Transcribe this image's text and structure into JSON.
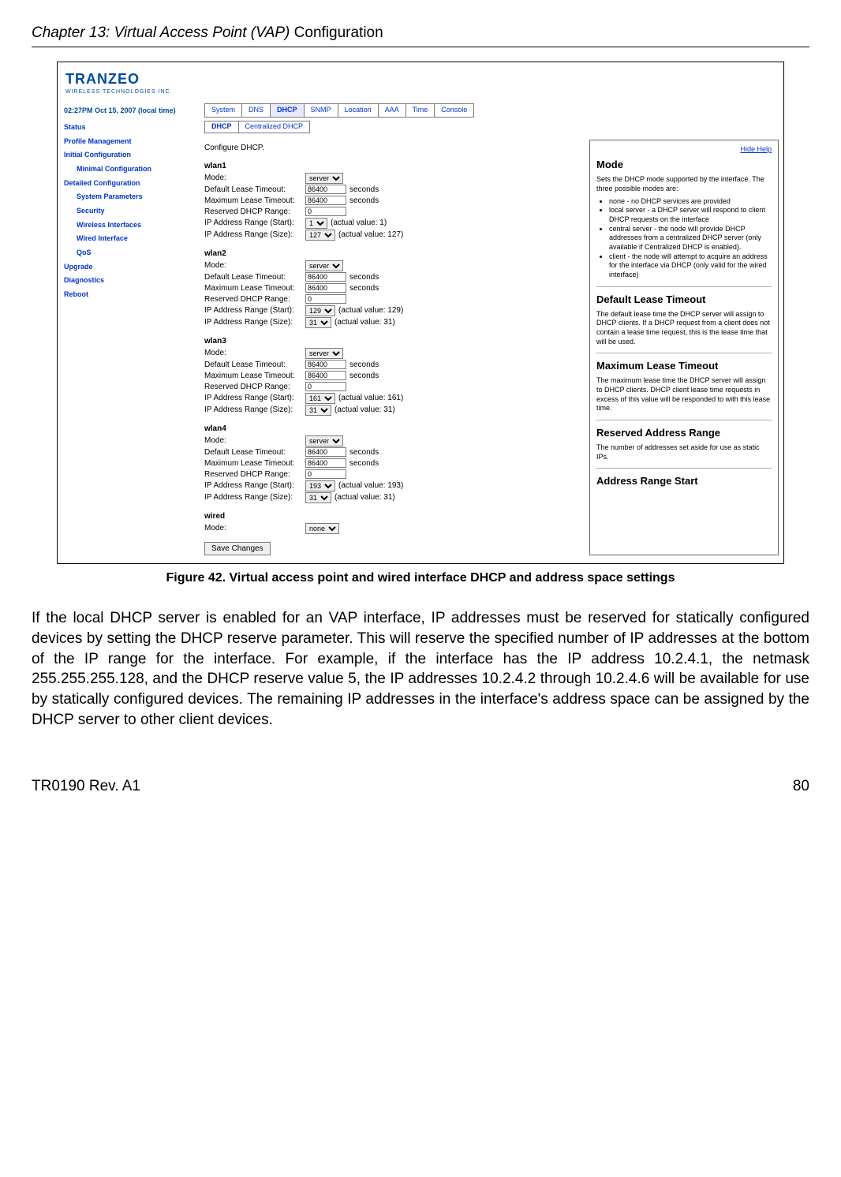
{
  "page": {
    "chapter_title_prefix": "Chapter 13: Virtual Access Point (VAP)",
    "chapter_title_suffix": "Configuration",
    "figure_caption": "Figure 42. Virtual access point and wired interface DHCP and address space settings",
    "body_paragraph": "If the local DHCP server is enabled for an VAP interface, IP addresses must be reserved for statically configured devices by setting the DHCP reserve parameter. This will reserve the specified number of IP addresses at the bottom of the IP range for the interface. For example, if the interface has the IP address 10.2.4.1, the netmask 255.255.255.128, and the DHCP reserve value 5, the IP addresses 10.2.4.2 through 10.2.4.6 will be available for use by statically configured devices. The remaining IP addresses in the interface's address space can be assigned by the DHCP server to other client devices.",
    "footer_left": "TR0190 Rev. A1",
    "footer_right": "80"
  },
  "shot": {
    "logo": "TRANZEO",
    "logo_sub": "WIRELESS  TECHNOLOGIES INC.",
    "timestamp": "02:27PM Oct 15, 2007 (local time)",
    "sidebar": {
      "items": [
        "Status",
        "Profile Management",
        "Initial Configuration",
        "Minimal Configuration",
        "Detailed Configuration",
        "System Parameters",
        "Security",
        "Wireless Interfaces",
        "Wired Interface",
        "QoS",
        "Upgrade",
        "Diagnostics",
        "Reboot"
      ]
    },
    "tabs": [
      "System",
      "DNS",
      "DHCP",
      "SNMP",
      "Location",
      "AAA",
      "Time",
      "Console"
    ],
    "subtabs": [
      "DHCP",
      "Centralized DHCP"
    ],
    "instruction": "Configure DHCP.",
    "labels": {
      "mode": "Mode:",
      "default_lease": "Default Lease Timeout:",
      "max_lease": "Maximum Lease Timeout:",
      "reserved": "Reserved DHCP Range:",
      "ip_start": "IP Address Range (Start):",
      "ip_size": "IP Address Range (Size):",
      "seconds": "seconds",
      "save": "Save Changes"
    },
    "interfaces": [
      {
        "name": "wlan1",
        "mode": "server",
        "def": "86400",
        "max": "86400",
        "res": "0",
        "start": "1",
        "start_actual": "(actual value: 1)",
        "size": "127",
        "size_actual": "(actual value: 127)"
      },
      {
        "name": "wlan2",
        "mode": "server",
        "def": "86400",
        "max": "86400",
        "res": "0",
        "start": "129",
        "start_actual": "(actual value: 129)",
        "size": "31",
        "size_actual": "(actual value: 31)"
      },
      {
        "name": "wlan3",
        "mode": "server",
        "def": "86400",
        "max": "86400",
        "res": "0",
        "start": "161",
        "start_actual": "(actual value: 161)",
        "size": "31",
        "size_actual": "(actual value: 31)"
      },
      {
        "name": "wlan4",
        "mode": "server",
        "def": "86400",
        "max": "86400",
        "res": "0",
        "start": "193",
        "start_actual": "(actual value: 193)",
        "size": "31",
        "size_actual": "(actual value: 31)"
      }
    ],
    "wired": {
      "name": "wired",
      "mode_label": "Mode:",
      "mode": "none"
    },
    "help": {
      "hide": "Hide Help",
      "mode_title": "Mode",
      "mode_text": "Sets the DHCP mode supported by the interface. The three possible modes are:",
      "mode_bullets": [
        "none - no DHCP services are provided",
        "local server - a DHCP server will respond to client DHCP requests on the interface",
        "central server - the node will provide DHCP addresses from a centralized DHCP server (only available if Centralized DHCP is enabled).",
        "client - the node will attempt to acquire an address for the interface via DHCP (only valid for the wired interface)"
      ],
      "dlt_title": "Default Lease Timeout",
      "dlt_text": "The default lease time the DHCP server will assign to DHCP clients. If a DHCP request from a client does not contain a lease time request, this is the lease time that will be used.",
      "mlt_title": "Maximum Lease Timeout",
      "mlt_text": "The maximum lease time the DHCP server will assign to DHCP clients. DHCP client lease time requests in excess of this value will be responded to with this lease time.",
      "rar_title": "Reserved Address Range",
      "rar_text": "The number of addresses set aside for use as static IPs.",
      "ars_title": "Address Range Start"
    }
  }
}
